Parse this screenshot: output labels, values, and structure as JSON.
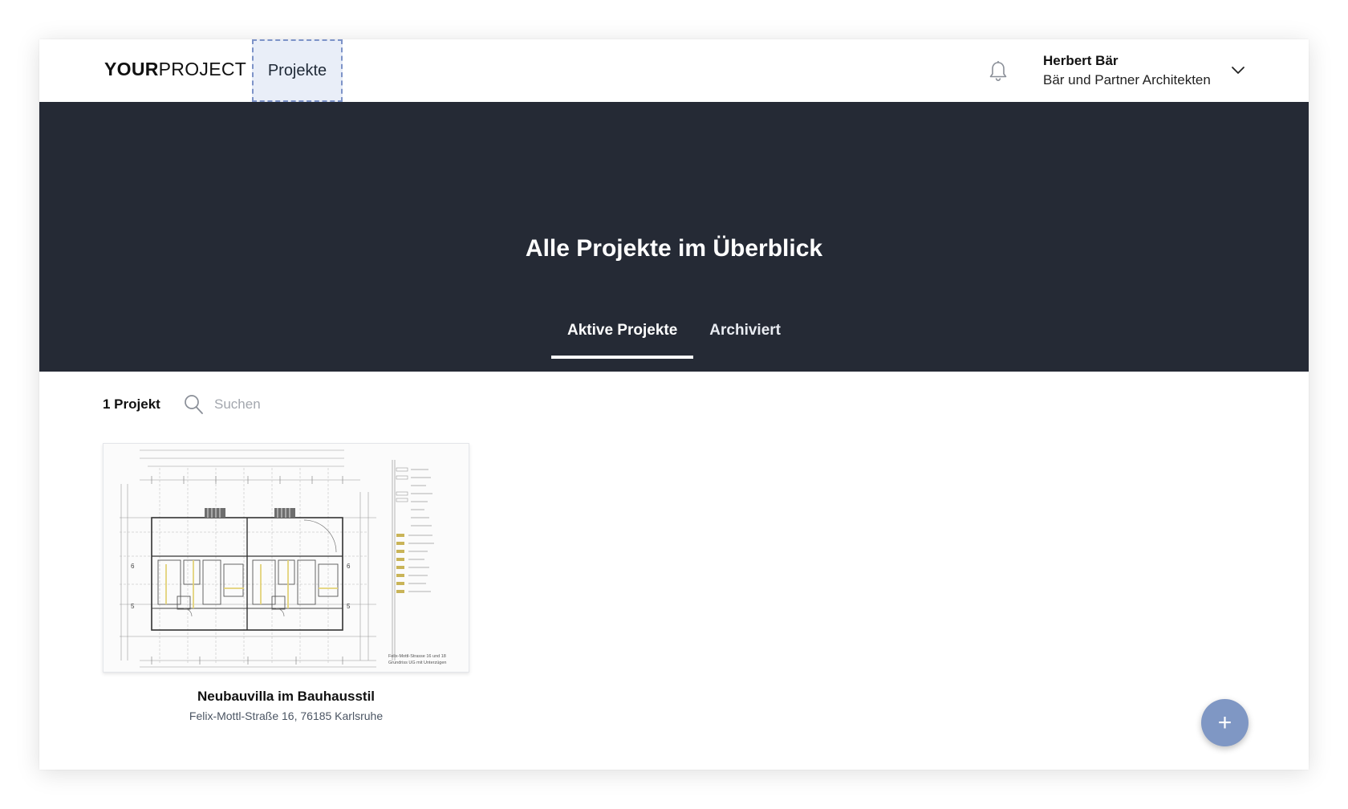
{
  "header": {
    "logo_bold": "YOUR",
    "logo_light": "PROJECT",
    "nav_projects": "Projekte",
    "user": {
      "name": "Herbert Bär",
      "company": "Bär und Partner Architekten"
    },
    "icons": {
      "notifications": "bell-icon",
      "user_menu": "chevron-down-icon"
    }
  },
  "hero": {
    "title": "Alle Projekte im Überblick",
    "tabs": [
      {
        "label": "Aktive Projekte",
        "active": true
      },
      {
        "label": "Archiviert",
        "active": false
      }
    ],
    "background": "#252a35"
  },
  "toolbar": {
    "count": "1 Projekt",
    "search": {
      "icon": "search-icon",
      "placeholder": "Suchen",
      "value": ""
    }
  },
  "projects": [
    {
      "title": "Neubauvilla im Bauhausstil",
      "address": "Felix-Mottl-Straße 16, 76185 Karlsruhe",
      "thumbnail": "floor-plan-drawing",
      "plan_caption_line1": "Felix-Mottl-Strasse 16 und 18",
      "plan_caption_line2": "Grundriss UG mit Unterzügen"
    }
  ],
  "fab": {
    "label": "+",
    "icon": "plus-icon"
  },
  "colors": {
    "accent": "#7f97c4",
    "nav_active_bg": "#e9eef8",
    "nav_active_border": "#7d93c8"
  }
}
